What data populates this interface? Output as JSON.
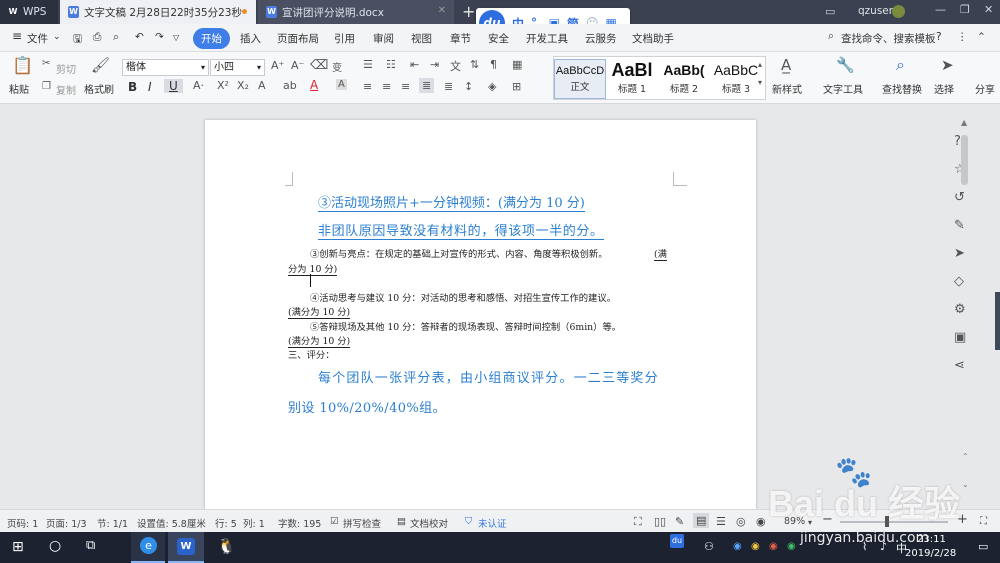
{
  "titlebar": {
    "app_tab": "WPS",
    "tabs": [
      {
        "label": "文字文稿 2月28日22时35分23秒",
        "icon": "W"
      },
      {
        "label": "宣讲团评分说明.docx",
        "icon": "W"
      }
    ],
    "new_tab": "+",
    "user": "qzuser"
  },
  "ime": {
    "logo": "du",
    "items": [
      "中",
      "°,",
      "简"
    ]
  },
  "menu": {
    "file": "文件",
    "items": [
      "开始",
      "插入",
      "页面布局",
      "引用",
      "审阅",
      "视图",
      "章节",
      "安全",
      "开发工具",
      "云服务",
      "文档助手"
    ],
    "search": "查找命令、搜索模板"
  },
  "ribbon": {
    "paste": "粘贴",
    "cut": "剪切",
    "copy": "复制",
    "format_painter": "格式刷",
    "font_name": "楷体",
    "font_size": "小四",
    "bold": "B",
    "italic": "I",
    "underline": "U",
    "styles": [
      {
        "preview": "AaBbCcD",
        "name": "正文"
      },
      {
        "preview": "AaBl",
        "name": "标题 1"
      },
      {
        "preview": "AaBb(",
        "name": "标题 2"
      },
      {
        "preview": "AaBbC",
        "name": "标题 3"
      }
    ],
    "new_style": "新样式",
    "text_tools": "文字工具",
    "find_replace": "查找替换",
    "select": "选择",
    "split": "分享"
  },
  "document": {
    "line1": "③活动现场照片+一分钟视频：(满分为 10 分)",
    "line2": "非团队原因导致没有材料的，得该项一半的分。",
    "line3a": "③创新与亮点：在规定的基础上对宣传的形式、内容、角度等积极创新。",
    "line3b": "(满",
    "line3c": "分为 10 分)",
    "line4a": "④活动思考与建议 10 分：对活动的思考和感悟、对招生宣传工作的建议。",
    "line4b": "(满分为 10 分)",
    "line5a": "⑤答辩现场及其他 10 分：答辩者的现场表现、答辩时间控制（6min）等。",
    "line5b": "(满分为 10 分)",
    "line6": "三、评分：",
    "line7": "每个团队一张评分表，由小组商议评分。一二三等奖分",
    "line8": "别设 10%/20%/40%组。"
  },
  "status": {
    "page": "页码: 1",
    "pages": "页面: 1/3",
    "section": "节: 1/1",
    "setting": "设置值: 5.8厘米",
    "row": "行: 5",
    "col": "列: 1",
    "words": "字数: 195",
    "spell": "拼写检查",
    "proof": "文档校对",
    "cert": "未认证",
    "zoom": "89%"
  },
  "taskbar": {
    "time": "23:11",
    "date": "2019/2/28"
  },
  "watermark": {
    "brand": "Bai du 经验",
    "url": "jingyan.baidu.com"
  }
}
